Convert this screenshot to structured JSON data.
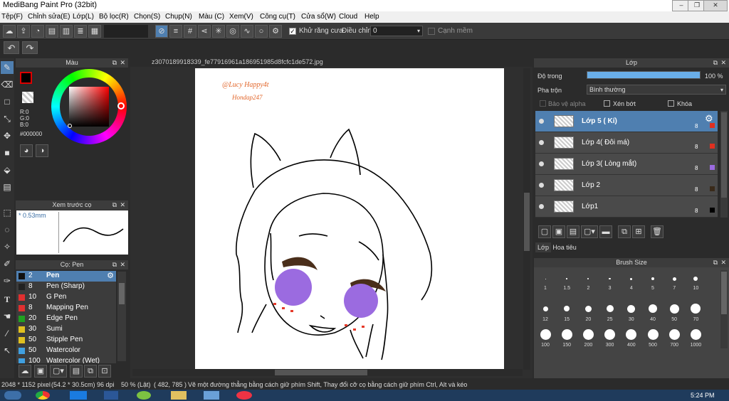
{
  "app_title": "MediBang Paint Pro (32bit)",
  "menu": [
    "Tệp(F)",
    "Chỉnh sửa(E)",
    "Lớp(L)",
    "Bộ lọc(R)",
    "Chọn(S)",
    "Chụp(N)",
    "Màu (C)",
    "Xem(V)",
    "Công cụ(T)",
    "Cửa sổ(W)",
    "Cloud",
    "Help"
  ],
  "toolbar": {
    "antialias_label": "Khử răng cưa",
    "adjust_label": "Điều chỉnh",
    "adjust_value": "0",
    "edge_label": "Cạnh mềm"
  },
  "color_panel": {
    "title": "Màu",
    "r": "R:0",
    "g": "G:0",
    "b": "B:0",
    "hex": "#000000"
  },
  "preview_panel": {
    "title": "Xem trước cọ",
    "size": "* 0.53mm"
  },
  "brush_panel": {
    "title": "Cọ: Pen",
    "items": [
      {
        "size": "2",
        "name": "Pen",
        "color": "#111111"
      },
      {
        "size": "8",
        "name": "Pen (Sharp)",
        "color": "#222222"
      },
      {
        "size": "10",
        "name": "G Pen",
        "color": "#e03030"
      },
      {
        "size": "8",
        "name": "Mapping Pen",
        "color": "#e03030"
      },
      {
        "size": "20",
        "name": "Edge Pen",
        "color": "#20a020"
      },
      {
        "size": "30",
        "name": "Sumi",
        "color": "#e0c020"
      },
      {
        "size": "50",
        "name": "Stipple Pen",
        "color": "#e0c020"
      },
      {
        "size": "50",
        "name": "Watercolor",
        "color": "#40a0e0"
      },
      {
        "size": "100",
        "name": "Watercolor (Wet)",
        "color": "#40a0e0"
      }
    ]
  },
  "document_tab": "z3070189918339_fe77916961a186951985d8fcfc1de572.jpg",
  "canvas_text": {
    "line1": "@Lucy Happy4t",
    "line2": "Hondap247"
  },
  "layer_panel": {
    "title": "Lớp",
    "opacity_label": "Độ trong",
    "opacity_value": "100 %",
    "opacity": 1.0,
    "blend_label": "Pha trộn",
    "blend_value": "Bình thường",
    "protect_alpha": "Bảo vệ alpha",
    "clipping": "Xén bớt",
    "lock": "Khóa",
    "layers": [
      {
        "name": "Lớp 5  ( Kí)",
        "count": "8",
        "color": "#e03020"
      },
      {
        "name": "Lớp 4( Đôi má)",
        "count": "8",
        "color": "#e03020"
      },
      {
        "name": "Lớp 3( Lòng mắt)",
        "count": "8",
        "color": "#9b6be0"
      },
      {
        "name": "Lớp 2",
        "count": "8",
        "color": "#3a2a1a"
      },
      {
        "name": "Lớp1",
        "count": "8",
        "color": "#000000"
      }
    ],
    "tabs": [
      "Lớp",
      "Hoa tiêu"
    ]
  },
  "brush_size_panel": {
    "title": "Brush Size",
    "sizes": [
      "1",
      "1.5",
      "2",
      "3",
      "4",
      "5",
      "7",
      "10",
      "12",
      "15",
      "20",
      "25",
      "30",
      "40",
      "50",
      "70",
      "100",
      "150",
      "200",
      "300",
      "400",
      "500",
      "700",
      "1000"
    ]
  },
  "status": {
    "dims": "2048 * 1152 pixel",
    "cm": "(54.2 * 30.5cm)",
    "dpi": "96 dpi",
    "zoom": "50 % (Lật)",
    "coords": "( 482, 785 )",
    "hint": "Vẽ một đường thẳng bằng cách giữ phím Shift, Thay đổi cỡ cọ bằng cách giữ phím Ctrl, Alt và kéo"
  },
  "taskbar": {
    "time": "5:24 PM"
  },
  "colors": {
    "accent": "#4f7fb0",
    "cheek": "#9b6be0",
    "brow": "#4a2e1a"
  }
}
